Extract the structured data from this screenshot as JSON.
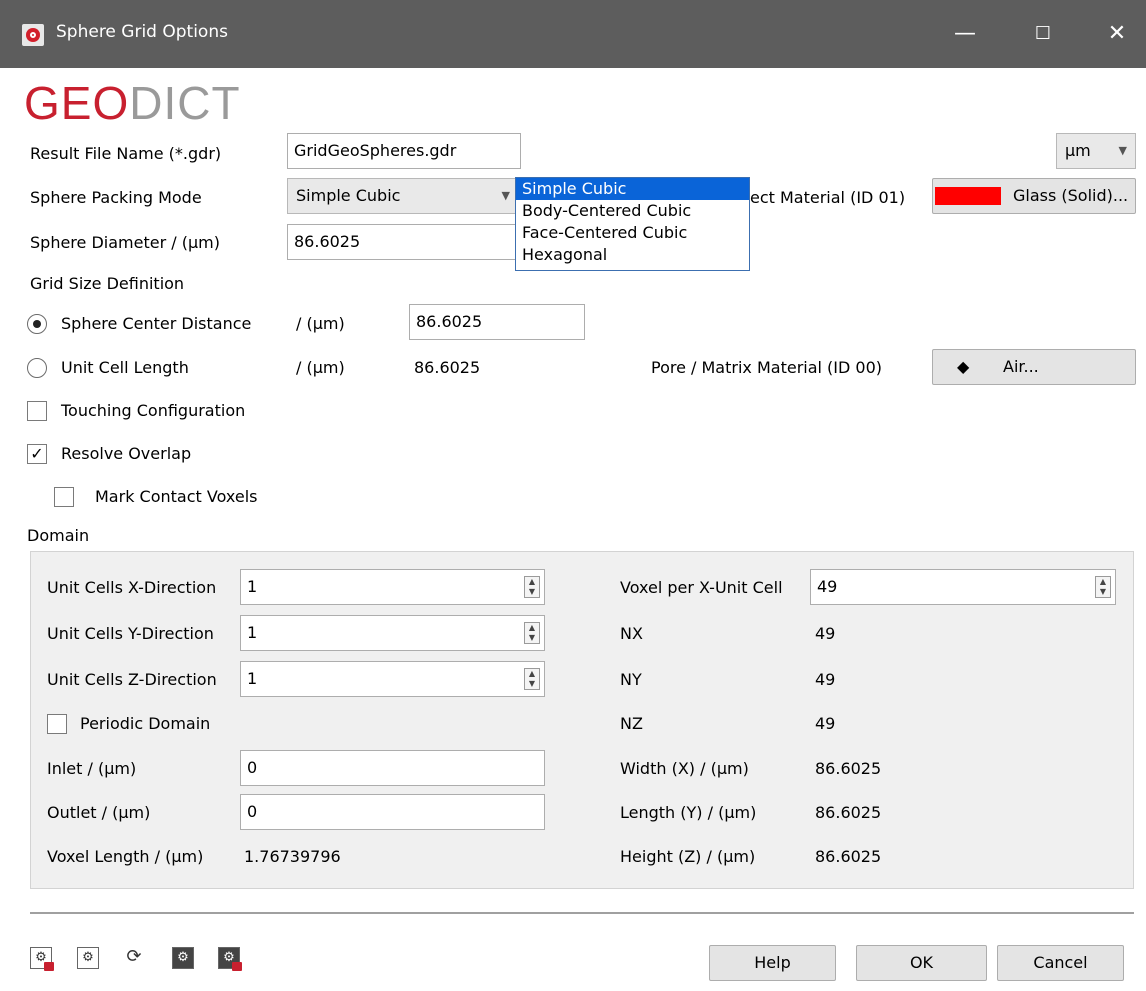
{
  "window": {
    "title": "Sphere Grid Options",
    "minimize_glyph": "—",
    "maximize_glyph": "☐",
    "close_glyph": "✕"
  },
  "logo": {
    "part1": "GEO",
    "part2": "DICT"
  },
  "form": {
    "result_file_label": "Result File Name (*.gdr)",
    "result_file_value": "GridGeoSpheres.gdr",
    "unit_value": "µm",
    "packing_mode_label": "Sphere Packing Mode",
    "packing_mode_value": "Simple Cubic",
    "packing_options": [
      "Simple Cubic",
      "Body-Centered Cubic",
      "Face-Centered Cubic",
      "Hexagonal"
    ],
    "object_material_label": "ect Material (ID 01)",
    "object_material_value": "Glass (Solid)...",
    "object_material_color": "#ff0000",
    "sphere_diameter_label": "Sphere Diameter / (µm)",
    "sphere_diameter_value": "86.6025",
    "grid_size_label": "Grid Size Definition",
    "center_distance_label": "Sphere Center Distance",
    "center_distance_unit": "/ (µm)",
    "center_distance_value": "86.6025",
    "unit_cell_label": "Unit Cell Length",
    "unit_cell_unit": "/ (µm)",
    "unit_cell_value": "86.6025",
    "pore_material_label": "Pore / Matrix Material (ID 00)",
    "pore_material_value": "Air...",
    "touching_label": "Touching Configuration",
    "resolve_overlap_label": "Resolve Overlap",
    "mark_contact_label": "Mark Contact Voxels",
    "check_mark": "✓"
  },
  "domain": {
    "title": "Domain",
    "cells_x_label": "Unit Cells X-Direction",
    "cells_x_value": "1",
    "cells_y_label": "Unit Cells Y-Direction",
    "cells_y_value": "1",
    "cells_z_label": "Unit Cells Z-Direction",
    "cells_z_value": "1",
    "periodic_label": "Periodic Domain",
    "inlet_label": "Inlet / (µm)",
    "inlet_value": "0",
    "outlet_label": "Outlet / (µm)",
    "outlet_value": "0",
    "voxel_length_label": "Voxel Length / (µm)",
    "voxel_length_value": "1.76739796",
    "voxel_per_x_label": "Voxel per X-Unit Cell",
    "voxel_per_x_value": "49",
    "nx_label": "NX",
    "nx_value": "49",
    "ny_label": "NY",
    "ny_value": "49",
    "nz_label": "NZ",
    "nz_value": "49",
    "width_label": "Width (X) / (µm)",
    "width_value": "86.6025",
    "length_label": "Length (Y) / (µm)",
    "length_value": "86.6025",
    "height_label": "Height (Z) / (µm)",
    "height_value": "86.6025"
  },
  "footer": {
    "help_label": "Help",
    "ok_label": "OK",
    "cancel_label": "Cancel",
    "toolbar_icons": [
      "load-settings-icon",
      "save-settings-icon",
      "reset-settings-icon",
      "macro-record-icon",
      "lock-settings-icon"
    ]
  }
}
